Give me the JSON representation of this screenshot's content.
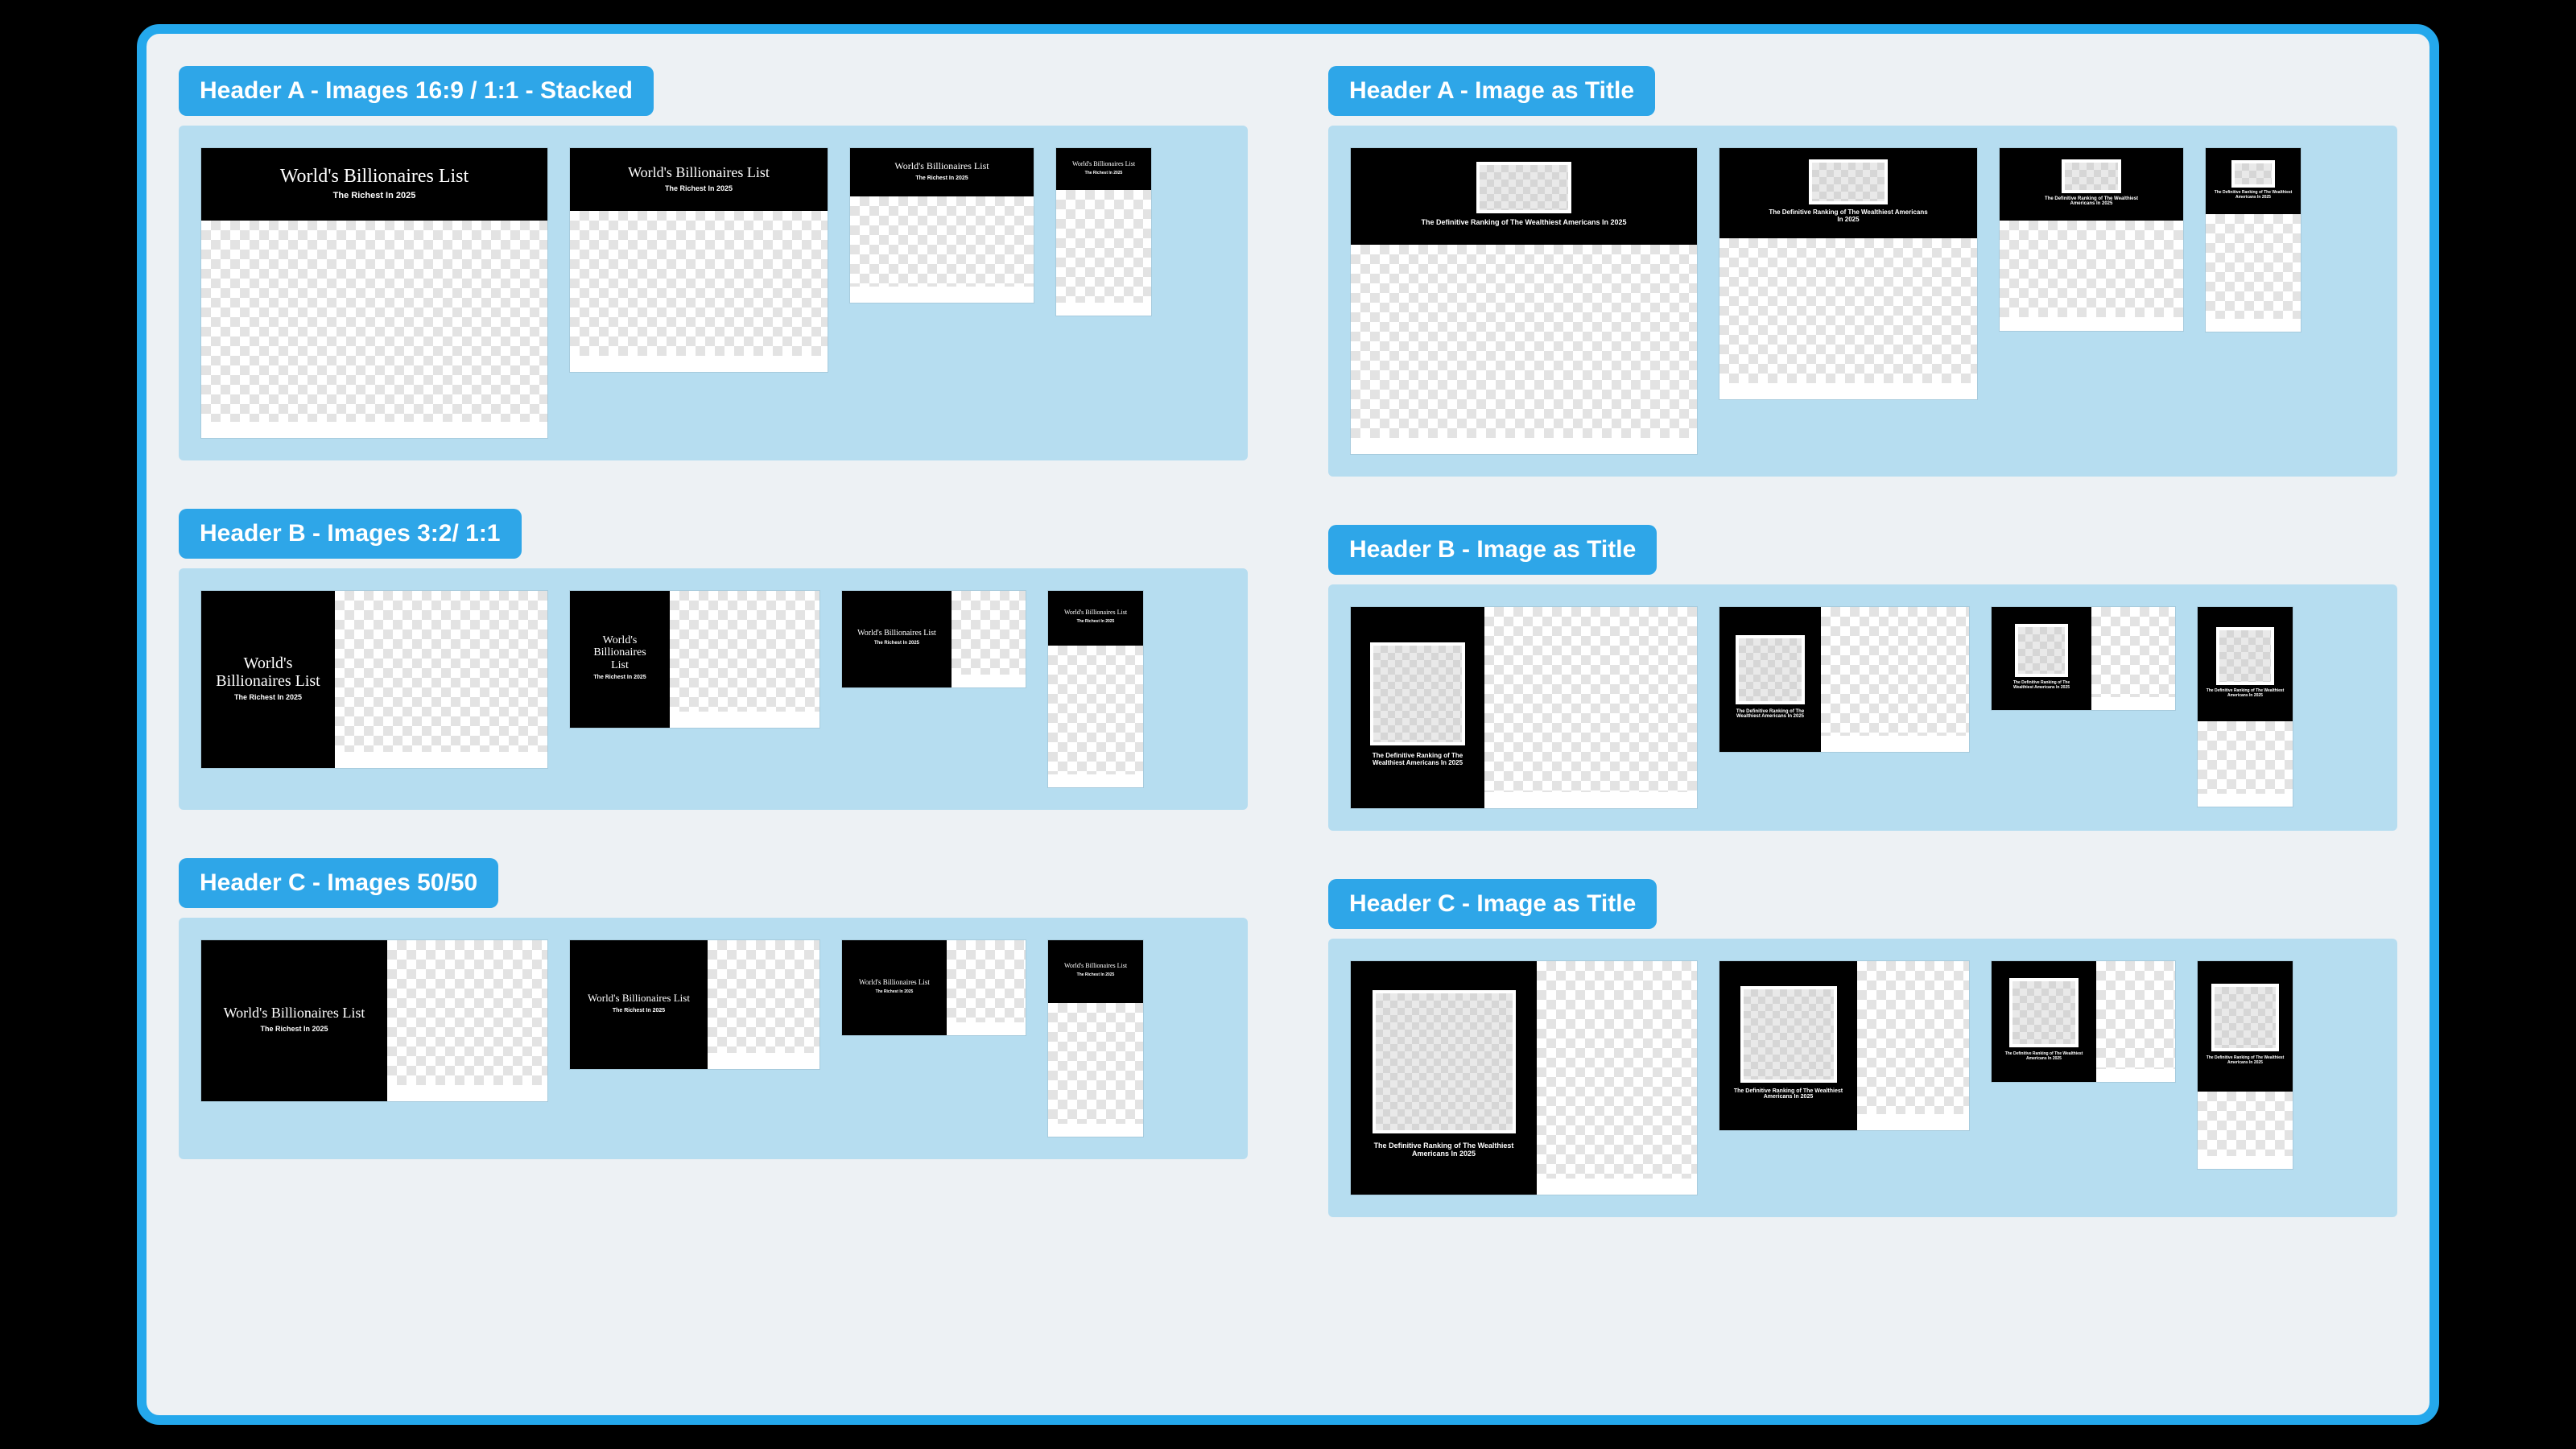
{
  "left": {
    "a": {
      "tab": "Header A - Images 16:9 / 1:1 - Stacked",
      "title": "World's Billionaires List",
      "subtitle": "The Richest In 2025",
      "meta": "",
      "foot1": "",
      "foot2": ""
    },
    "b": {
      "tab": "Header B - Images 3:2/ 1:1",
      "title": "World's Billionaires List",
      "subtitle": "The Richest In 2025",
      "meta": "",
      "foot1": "",
      "foot2": ""
    },
    "c": {
      "tab": "Header C - Images 50/50",
      "title": "World's Billionaires List",
      "subtitle": "The Richest In 2025",
      "meta": "",
      "foot1": "",
      "foot2": ""
    }
  },
  "right": {
    "a": {
      "tab": "Header A - Image as Title",
      "caption": "The Definitive Ranking of The Wealthiest Americans In 2025",
      "meta": "",
      "foot1": "",
      "foot2": ""
    },
    "b": {
      "tab": "Header B - Image as Title",
      "caption": "The Definitive Ranking of The Wealthiest Americans In 2025",
      "meta": "",
      "foot1": "",
      "foot2": ""
    },
    "c": {
      "tab": "Header C - Image as Title",
      "caption": "The Definitive Ranking of The Wealthiest Americans In 2025",
      "meta": "",
      "foot1": "",
      "foot2": ""
    }
  }
}
